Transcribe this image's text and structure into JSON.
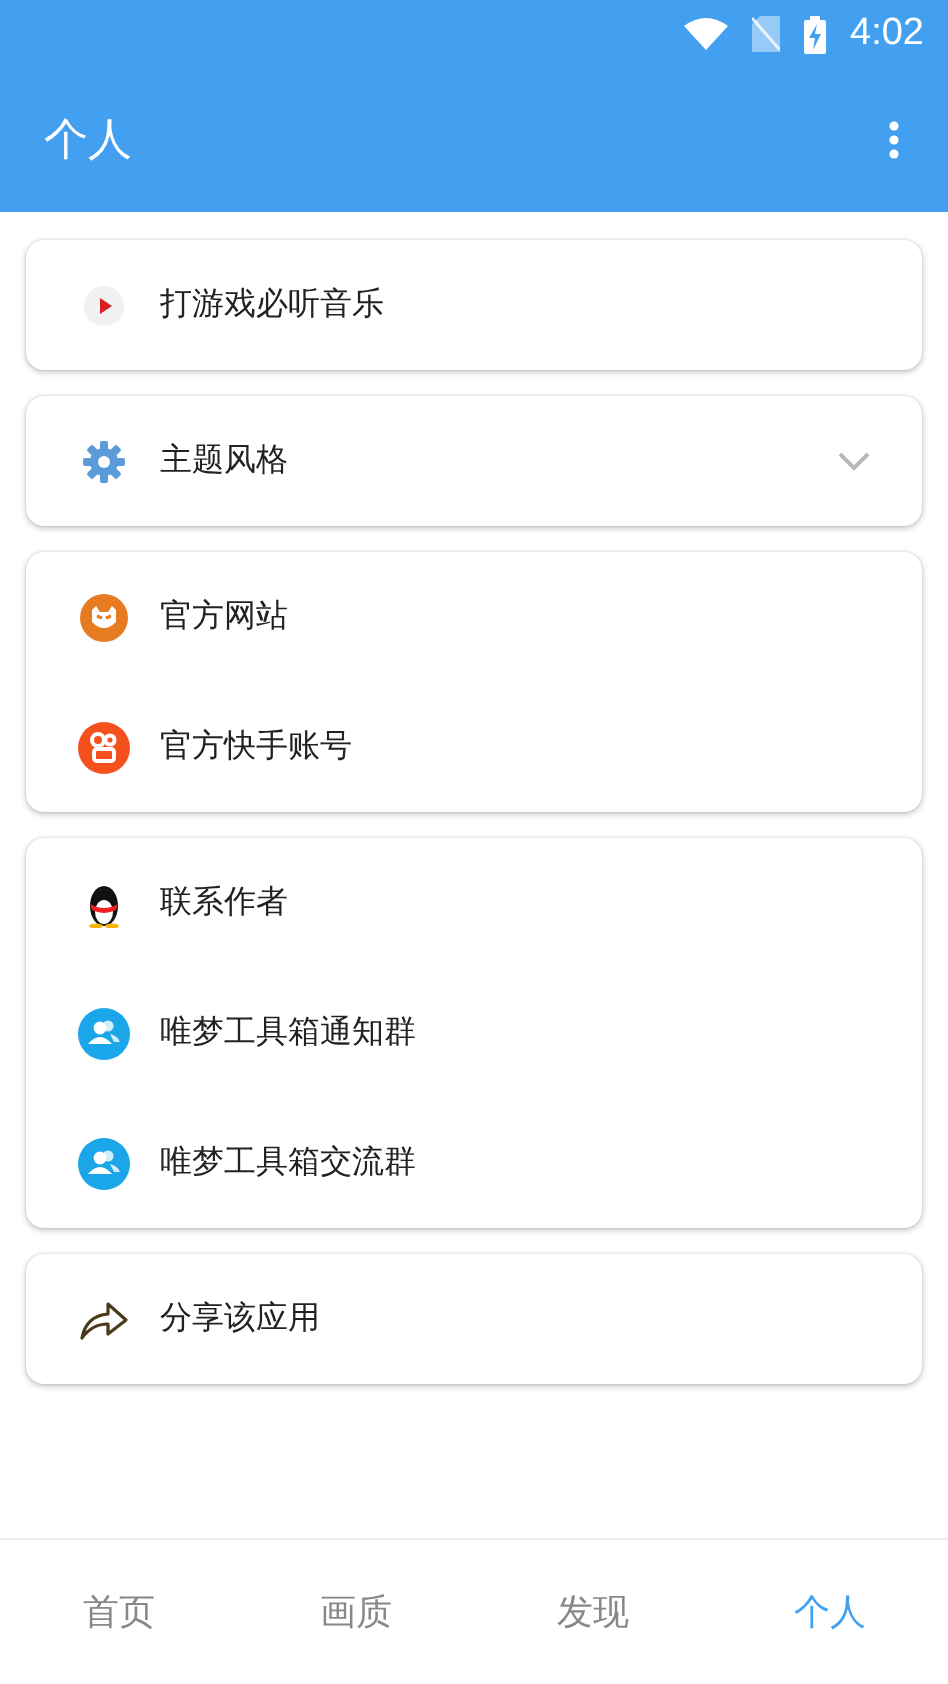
{
  "status_bar": {
    "time": "4:02"
  },
  "app_bar": {
    "title": "个人"
  },
  "cards": [
    {
      "items": [
        {
          "kind": "play",
          "label": "打游戏必听音乐"
        }
      ]
    },
    {
      "items": [
        {
          "kind": "gear",
          "label": "主题风格",
          "expanded": false
        }
      ]
    },
    {
      "items": [
        {
          "kind": "mascot",
          "label": "官方网站"
        },
        {
          "kind": "kuaishou",
          "label": "官方快手账号"
        }
      ]
    },
    {
      "items": [
        {
          "kind": "penguin",
          "label": "联系作者"
        },
        {
          "kind": "group",
          "label": "唯梦工具箱通知群"
        },
        {
          "kind": "group",
          "label": "唯梦工具箱交流群"
        }
      ]
    },
    {
      "items": [
        {
          "kind": "share",
          "label": "分享该应用"
        }
      ]
    }
  ],
  "bottom_nav": [
    {
      "label": "首页",
      "selected": false
    },
    {
      "label": "画质",
      "selected": false
    },
    {
      "label": "发现",
      "selected": false
    },
    {
      "label": "个人",
      "selected": true
    }
  ]
}
